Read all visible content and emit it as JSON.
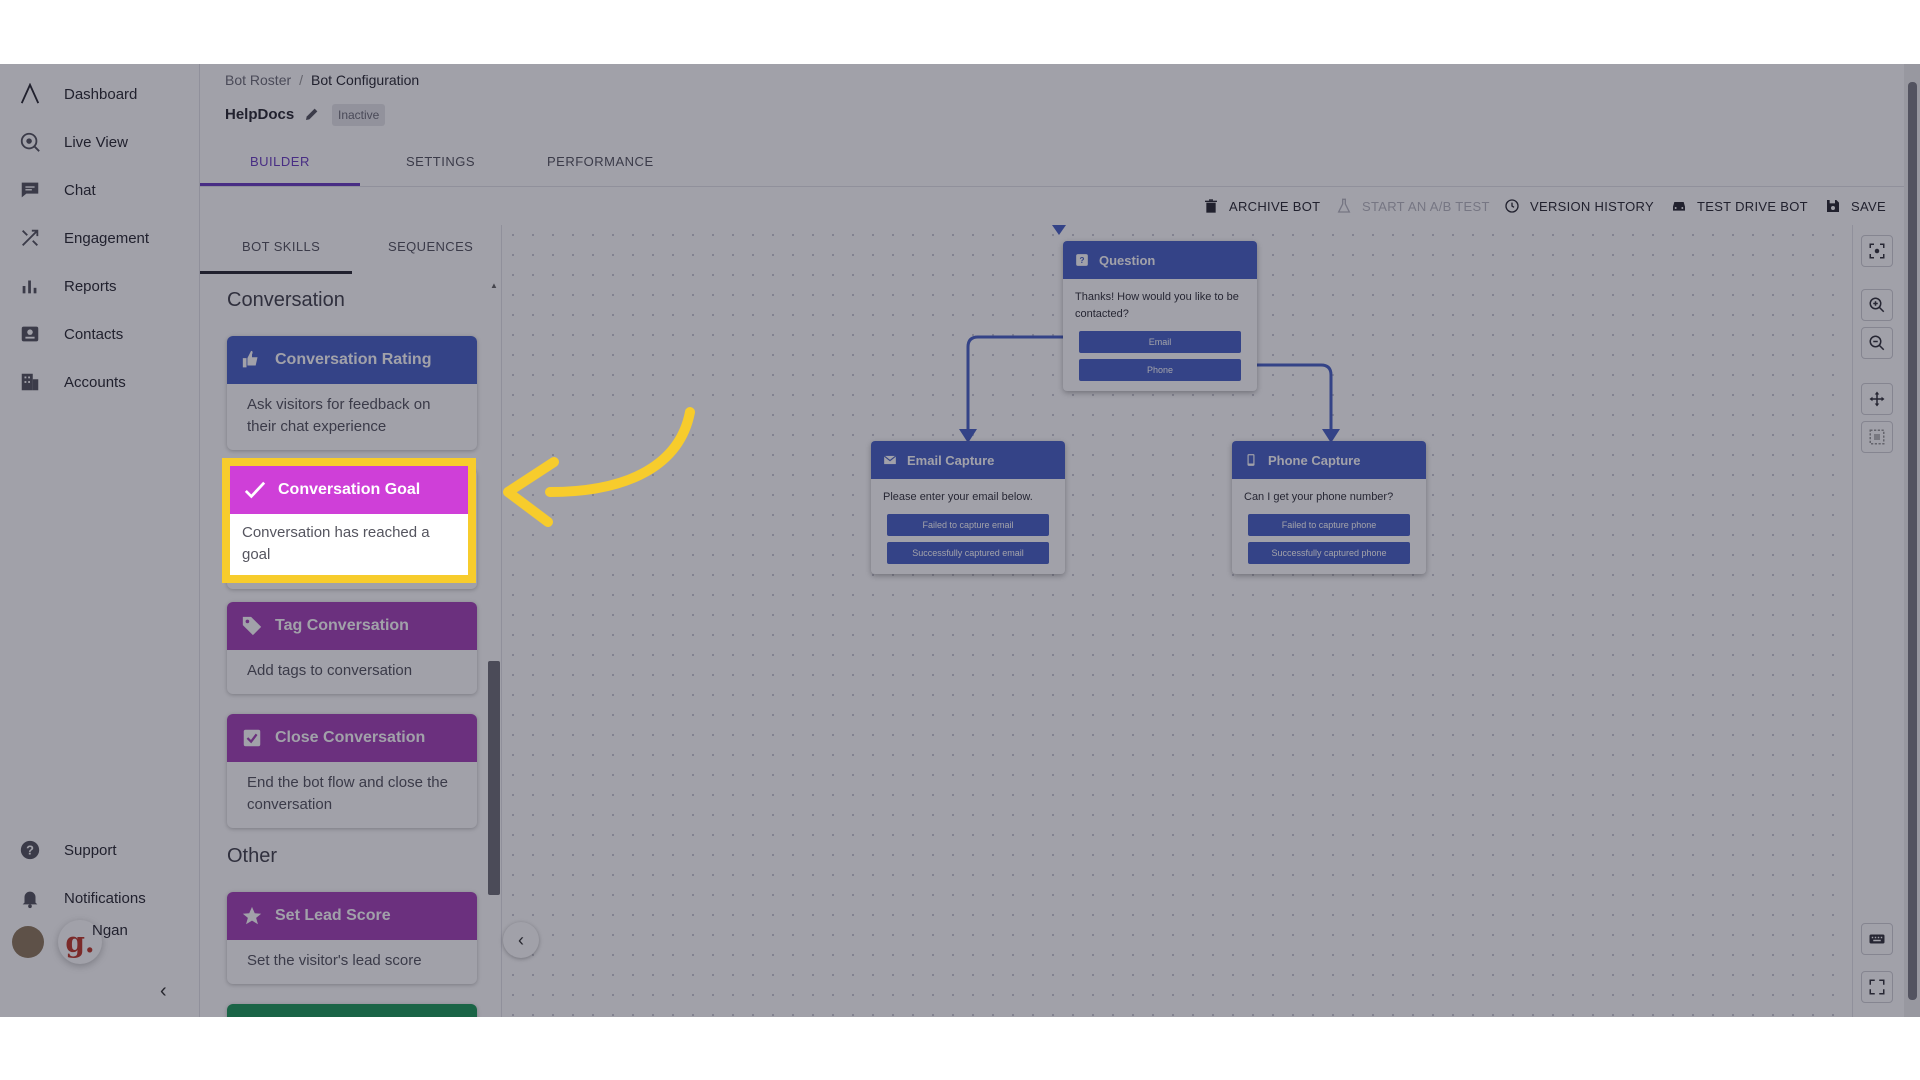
{
  "nav": {
    "items": [
      {
        "label": "Dashboard",
        "icon": "logo-icon"
      },
      {
        "label": "Live View",
        "icon": "live-view-icon"
      },
      {
        "label": "Chat",
        "icon": "chat-icon"
      },
      {
        "label": "Engagement",
        "icon": "engagement-icon"
      },
      {
        "label": "Reports",
        "icon": "reports-icon"
      },
      {
        "label": "Contacts",
        "icon": "contacts-icon"
      },
      {
        "label": "Accounts",
        "icon": "accounts-icon"
      }
    ],
    "bottom": [
      {
        "label": "Support",
        "icon": "support-icon"
      },
      {
        "label": "Notifications",
        "icon": "bell-icon"
      }
    ],
    "user_name": "Ngan",
    "user_badge": "g."
  },
  "header": {
    "breadcrumb_parent": "Bot Roster",
    "breadcrumb_sep": "/",
    "breadcrumb_current": "Bot Configuration",
    "bot_name": "HelpDocs",
    "status": "Inactive",
    "tabs": [
      "BUILDER",
      "SETTINGS",
      "PERFORMANCE"
    ]
  },
  "toolbar": {
    "archive": "ARCHIVE BOT",
    "ab_test": "START AN A/B TEST",
    "version_history": "VERSION HISTORY",
    "test_drive": "TEST DRIVE BOT",
    "save": "SAVE"
  },
  "skills": {
    "sub_tabs": [
      "BOT SKILLS",
      "SEQUENCES"
    ],
    "sections": [
      "Conversation",
      "Other"
    ],
    "cards": [
      {
        "title": "Conversation Rating",
        "desc": "Ask visitors for feedback on their chat experience",
        "color": "#4a63c7"
      },
      {
        "title": "Conversation Goal",
        "desc": "Conversation has reached a goal",
        "color": "#cf3fd8"
      },
      {
        "title": "Tag Conversation",
        "desc": "Add tags to conversation",
        "color": "#a543b8"
      },
      {
        "title": "Close Conversation",
        "desc": "End the bot flow and close the conversation",
        "color": "#a543b8"
      },
      {
        "title": "Set Lead Score",
        "desc": "Set the visitor's lead score",
        "color": "#a543b8"
      }
    ]
  },
  "canvas": {
    "question": {
      "title": "Question",
      "text": "Thanks! How would you like to be contacted?",
      "options": [
        "Email",
        "Phone"
      ]
    },
    "email": {
      "title": "Email Capture",
      "text": "Please enter your email below.",
      "options": [
        "Failed to capture email",
        "Successfully captured email"
      ]
    },
    "phone": {
      "title": "Phone Capture",
      "text": "Can I get your phone number?",
      "options": [
        "Failed to capture phone",
        "Successfully captured phone"
      ]
    }
  },
  "colors": {
    "accent": "#6b3fc2",
    "node": "#4a63c7",
    "highlight": "#f7cc2c"
  }
}
